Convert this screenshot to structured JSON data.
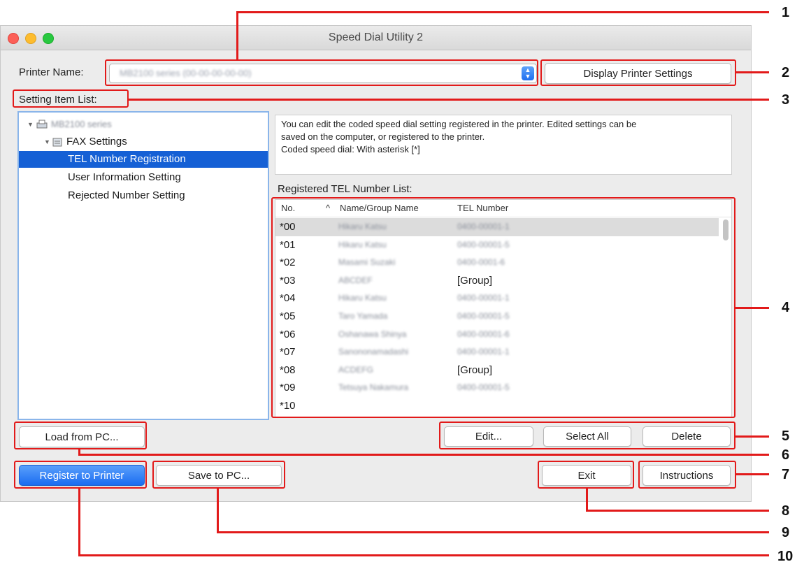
{
  "window": {
    "title": "Speed Dial Utility 2"
  },
  "printer": {
    "label": "Printer Name:",
    "value": "MB2100 series (00-00-00-00-00)",
    "display_settings_button": "Display Printer Settings"
  },
  "setting_item_list": {
    "label": "Setting Item List:",
    "items": [
      {
        "label": "MB2100 series"
      },
      {
        "label": "FAX Settings"
      },
      {
        "label": "TEL Number Registration"
      },
      {
        "label": "User Information Setting"
      },
      {
        "label": "Rejected Number Setting"
      }
    ]
  },
  "description": {
    "lines": [
      "You can edit the coded speed dial setting registered in the printer. Edited settings can be",
      "saved on the computer, or registered to the printer.",
      "Coded speed dial: With asterisk [*]"
    ]
  },
  "tel_list": {
    "label": "Registered TEL Number List:",
    "columns": {
      "no": "No.",
      "sort_indicator": "^",
      "name": "Name/Group Name",
      "tel": "TEL Number"
    },
    "rows": [
      {
        "no": "*00",
        "name": "Hikaru Katsu",
        "tel": "0400-00001-1"
      },
      {
        "no": "*01",
        "name": "Hikaru Katsu",
        "tel": "0400-00001-5"
      },
      {
        "no": "*02",
        "name": "Masami Suzaki",
        "tel": "0400-0001-6"
      },
      {
        "no": "*03",
        "name": "ABCDEF",
        "tel": "[Group]"
      },
      {
        "no": "*04",
        "name": "Hikaru Katsu",
        "tel": "0400-00001-1"
      },
      {
        "no": "*05",
        "name": "Taro Yamada",
        "tel": "0400-00001-5"
      },
      {
        "no": "*06",
        "name": "Oshanawa Shinya",
        "tel": "0400-00001-6"
      },
      {
        "no": "*07",
        "name": "Sanononamadashi",
        "tel": "0400-00001-1"
      },
      {
        "no": "*08",
        "name": "ACDEFG",
        "tel": "[Group]"
      },
      {
        "no": "*09",
        "name": "Tetsuya Nakamura",
        "tel": "0400-00001-5"
      },
      {
        "no": "*10",
        "name": "",
        "tel": ""
      }
    ]
  },
  "buttons": {
    "edit": "Edit...",
    "select_all": "Select All",
    "delete": "Delete",
    "load_from_pc": "Load from PC...",
    "register_to_printer": "Register to Printer",
    "save_to_pc": "Save to PC...",
    "exit": "Exit",
    "instructions": "Instructions"
  },
  "callouts": [
    "1",
    "2",
    "3",
    "4",
    "5",
    "6",
    "7",
    "8",
    "9",
    "10"
  ],
  "colors": {
    "callout": "#e21a1a",
    "selection": "#1560d5",
    "primary_button": "#1a6cf1"
  }
}
